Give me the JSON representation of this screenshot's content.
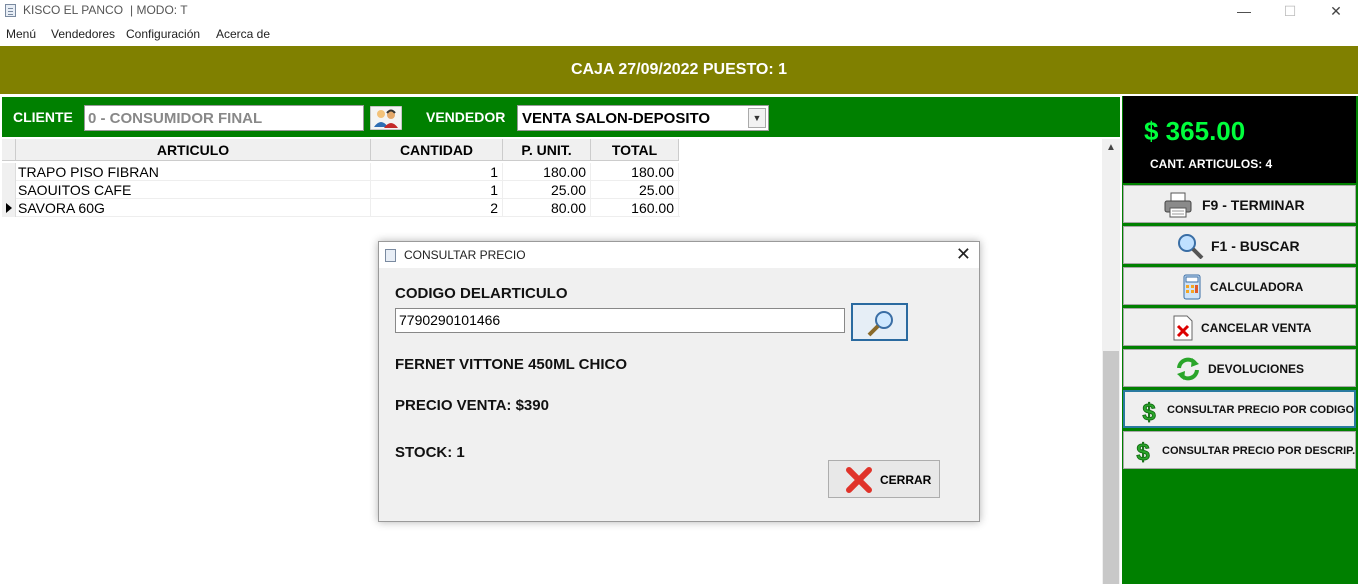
{
  "window": {
    "title": "KISCO EL PANCO",
    "mode": "| MODO: T",
    "minimize": "—",
    "maximize": "☐",
    "close": "✕"
  },
  "menu": [
    "Menú",
    "Vendedores",
    "Configuración",
    "Acerca de"
  ],
  "banner": "CAJA 27/09/2022  PUESTO: 1",
  "client_bar": {
    "cliente_label": "CLIENTE",
    "cliente_value": "0 - CONSUMIDOR FINAL",
    "vendedor_label": "VENDEDOR",
    "vendedor_value": "VENTA SALON-DEPOSITO"
  },
  "grid": {
    "headers": [
      "ARTICULO",
      "CANTIDAD",
      "P. UNIT.",
      "TOTAL"
    ],
    "rows": [
      {
        "articulo": "TRAPO PISO FIBRAN",
        "cantidad": "1",
        "punit": "180.00",
        "total": "180.00"
      },
      {
        "articulo": "SAOUITOS CAFE",
        "cantidad": "1",
        "punit": "25.00",
        "total": "25.00"
      },
      {
        "articulo": "SAVORA 60G",
        "cantidad": "2",
        "punit": "80.00",
        "total": "160.00"
      }
    ]
  },
  "side": {
    "total": "$ 365.00",
    "cant": "CANT. ARTICULOS:  4",
    "buttons": [
      {
        "label": "F9 - TERMINAR",
        "icon": "printer-icon"
      },
      {
        "label": "F1 - BUSCAR",
        "icon": "magnifier-icon"
      },
      {
        "label": "CALCULADORA",
        "icon": "calculator-icon"
      },
      {
        "label": "CANCELAR VENTA",
        "icon": "cancel-document-icon"
      },
      {
        "label": "DEVOLUCIONES",
        "icon": "refresh-icon"
      },
      {
        "label": "CONSULTAR PRECIO POR CODIGO",
        "icon": "dollar-icon"
      },
      {
        "label": "CONSULTAR PRECIO POR DESCRIP.",
        "icon": "dollar-icon"
      }
    ]
  },
  "dialog": {
    "title": "CONSULTAR PRECIO",
    "code_label": "CODIGO DELARTICULO",
    "code_value": "7790290101466",
    "product": "FERNET VITTONE 450ML CHICO",
    "price": "PRECIO VENTA: $390",
    "stock": "STOCK: 1",
    "close_label": "CERRAR"
  },
  "colors": {
    "banner": "#808000",
    "green": "#008000",
    "total_text": "#00ff3c"
  }
}
